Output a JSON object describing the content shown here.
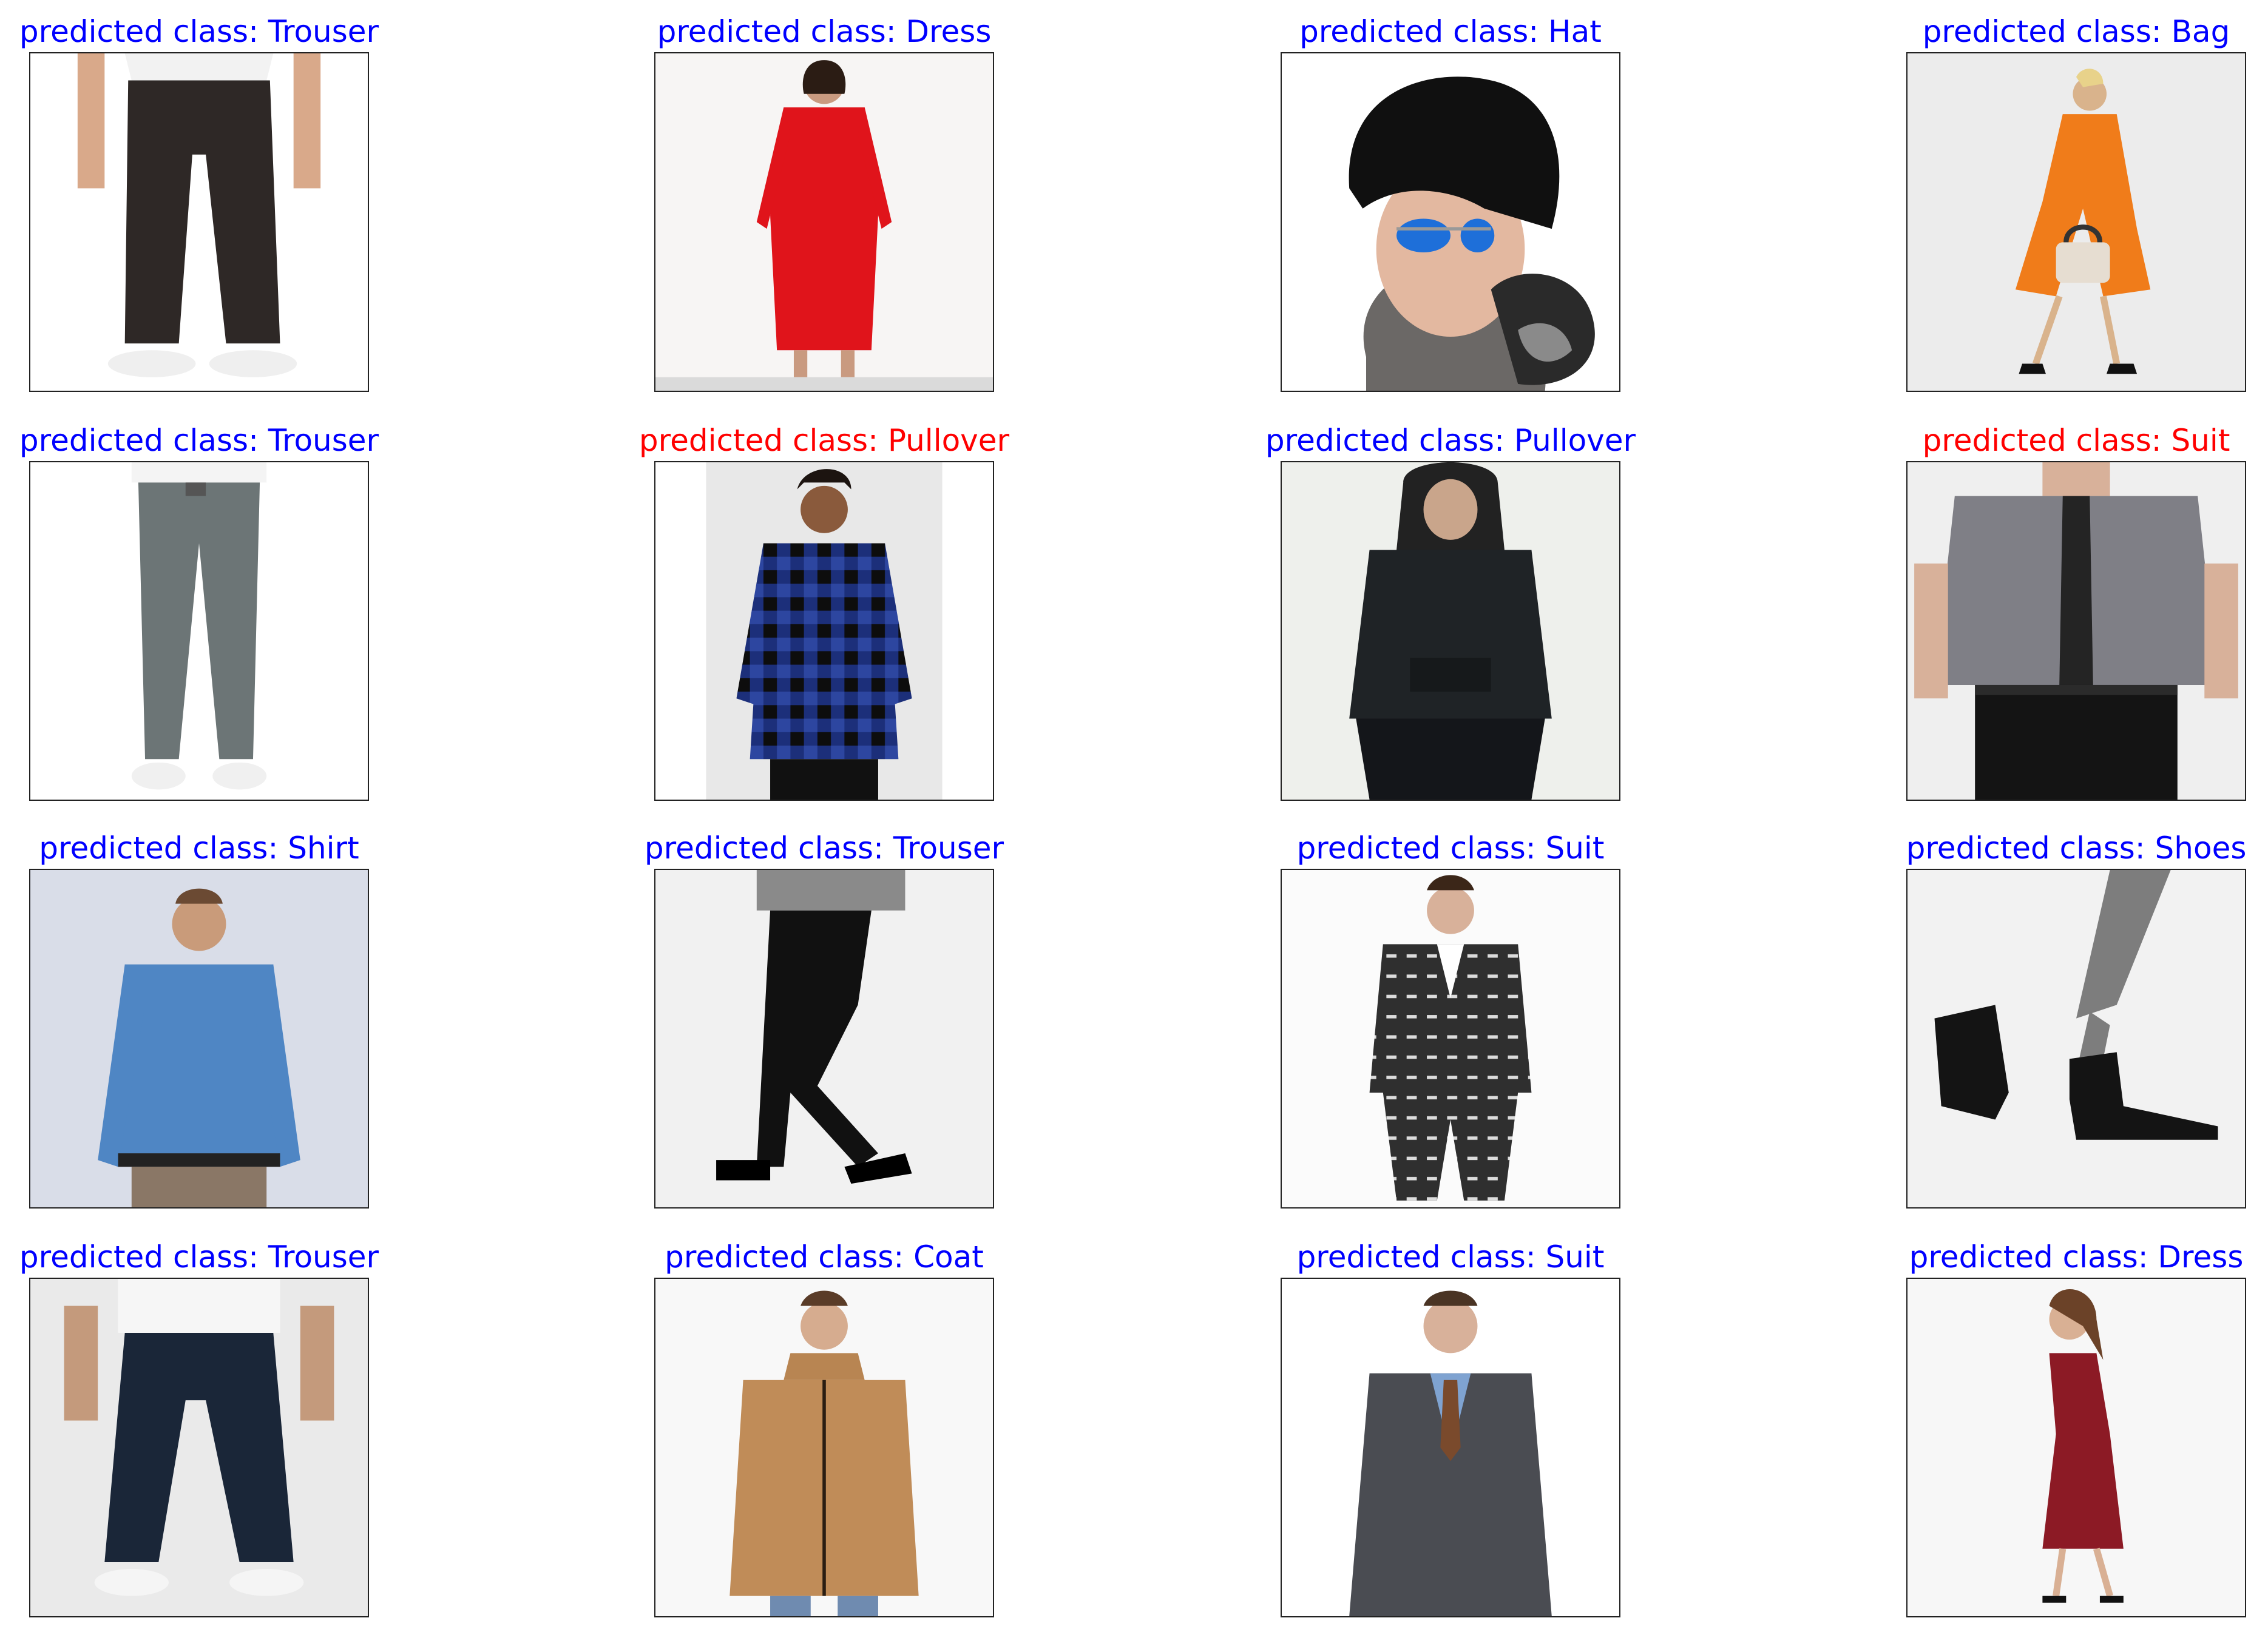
{
  "figure": {
    "items": [
      {
        "label": "predicted class: Trouser",
        "color": "#0000ff",
        "scene": "trouser-white-shirt"
      },
      {
        "label": "predicted class: Dress",
        "color": "#0000ff",
        "scene": "red-dress"
      },
      {
        "label": "predicted class: Hat",
        "color": "#0000ff",
        "scene": "black-beanie"
      },
      {
        "label": "predicted class: Bag",
        "color": "#0000ff",
        "scene": "orange-coat-bag"
      },
      {
        "label": "predicted class: Trouser",
        "color": "#0000ff",
        "scene": "grey-trouser"
      },
      {
        "label": "predicted class: Pullover",
        "color": "#ff0000",
        "scene": "plaid-shirt"
      },
      {
        "label": "predicted class: Pullover",
        "color": "#0000ff",
        "scene": "black-hoodie"
      },
      {
        "label": "predicted class: Suit",
        "color": "#ff0000",
        "scene": "grey-shirt-tie"
      },
      {
        "label": "predicted class: Shirt",
        "color": "#0000ff",
        "scene": "blue-shirt"
      },
      {
        "label": "predicted class: Trouser",
        "color": "#0000ff",
        "scene": "black-leggings"
      },
      {
        "label": "predicted class: Suit",
        "color": "#0000ff",
        "scene": "patterned-suit"
      },
      {
        "label": "predicted class: Shoes",
        "color": "#0000ff",
        "scene": "ankle-boots"
      },
      {
        "label": "predicted class: Trouser",
        "color": "#0000ff",
        "scene": "navy-chinos"
      },
      {
        "label": "predicted class: Coat",
        "color": "#0000ff",
        "scene": "camel-coat"
      },
      {
        "label": "predicted class: Suit",
        "color": "#0000ff",
        "scene": "grey-suit"
      },
      {
        "label": "predicted class: Dress",
        "color": "#0000ff",
        "scene": "burgundy-dress"
      }
    ]
  }
}
